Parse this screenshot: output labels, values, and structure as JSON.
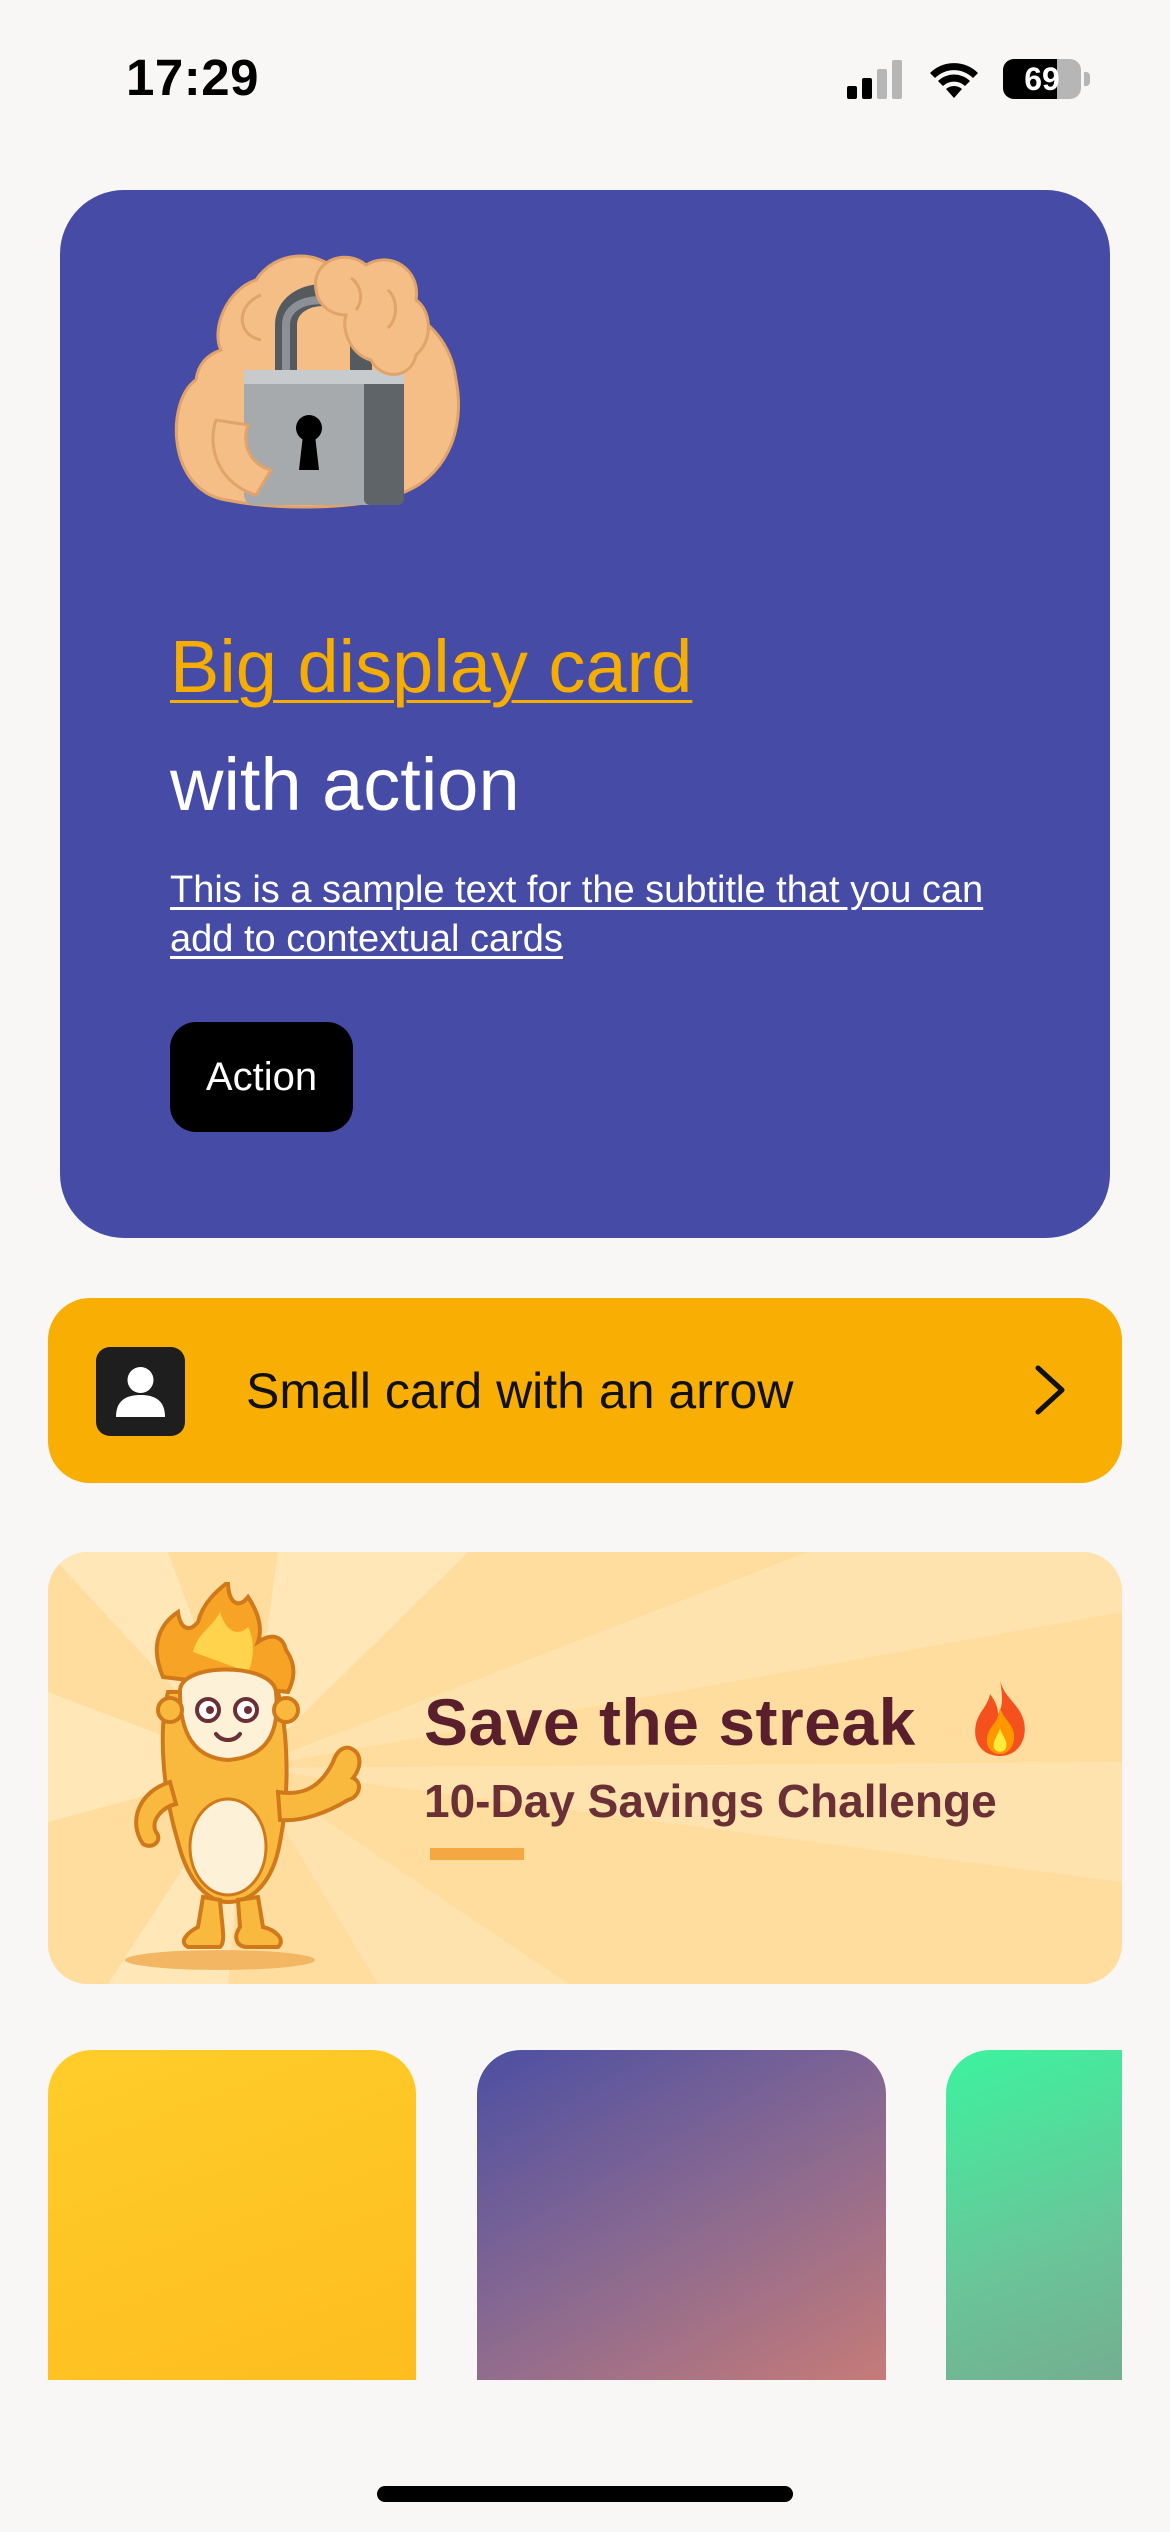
{
  "status_bar": {
    "time": "17:29",
    "battery_level": "69",
    "battery_fraction": 0.69,
    "signal_bars_active": 2,
    "signal_bars_total": 4
  },
  "big_card": {
    "title": "Big display card",
    "subtitle": "with action",
    "description": "This is a sample text for the subtitle that you can add to contextual cards",
    "action_label": "Action",
    "icon": "lock-in-hand-icon",
    "background_color": "#464ca6",
    "title_color": "#f5ad00"
  },
  "small_card": {
    "label": "Small card with an arrow",
    "leading_icon": "person-icon",
    "trailing_icon": "chevron-right-icon",
    "background_color": "#f9ae03"
  },
  "streak_banner": {
    "title": "Save the streak",
    "title_icon": "fire-icon",
    "subtitle": "10-Day Savings Challenge",
    "mascot": "flame-mascot",
    "background_color": "#ffdd9e"
  },
  "carousel": {
    "tiles": [
      {
        "name": "yellow-tile",
        "color": "#ffcd2a"
      },
      {
        "name": "purple-tile",
        "color": "#4c4fa3"
      },
      {
        "name": "green-tile",
        "color": "#3cf39e"
      }
    ]
  }
}
